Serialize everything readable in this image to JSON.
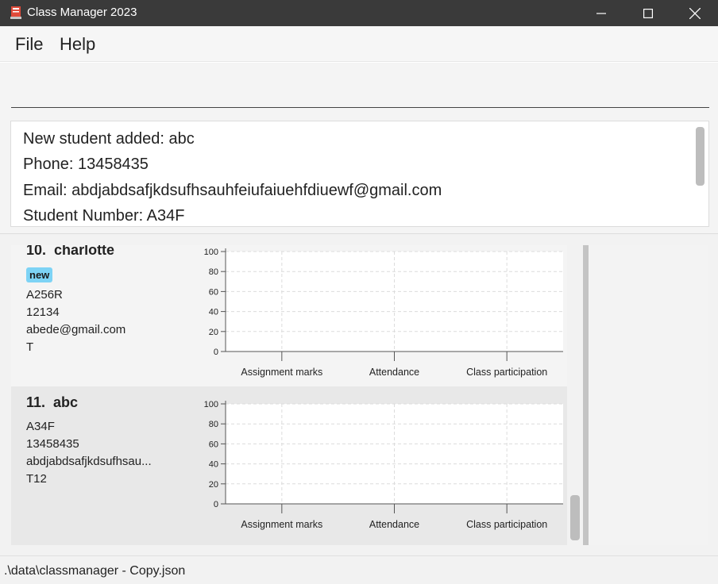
{
  "window": {
    "title": "Class Manager 2023"
  },
  "menu": {
    "file": "File",
    "help": "Help"
  },
  "command": {
    "value": ""
  },
  "result": {
    "lines": [
      "New student added: abc",
      "Phone: 13458435",
      "Email: abdjabdsafjkdsufhsauhfeiufaiuehfdiuewf@gmail.com",
      "Student Number: A34F"
    ]
  },
  "students": [
    {
      "index": "10.",
      "name": "charlotte",
      "tag": "new",
      "student_number": "A256R",
      "phone": "12134",
      "email": "abede@gmail.com",
      "class": "T"
    },
    {
      "index": "11.",
      "name": "abc",
      "student_number": "A34F",
      "phone": "13458435",
      "email": "abdjabdsafjkdsufhsau...",
      "class": "T12"
    }
  ],
  "chart_data": [
    {
      "type": "bar",
      "categories": [
        "Assignment marks",
        "Attendance",
        "Class participation"
      ],
      "values": [
        0,
        0,
        0
      ],
      "ylim": [
        0,
        100
      ],
      "yticks": [
        "0",
        "20",
        "40",
        "60",
        "80",
        "100"
      ],
      "grid": true
    },
    {
      "type": "bar",
      "categories": [
        "Assignment marks",
        "Attendance",
        "Class participation"
      ],
      "values": [
        0,
        0,
        0
      ],
      "ylim": [
        0,
        100
      ],
      "yticks": [
        "0",
        "20",
        "40",
        "60",
        "80",
        "100"
      ],
      "grid": true
    }
  ],
  "status": {
    "file_path": ".\\data\\classmanager - Copy.json"
  },
  "colors": {
    "titlebar": "#3a3a3a",
    "tag": "#7dd3f5",
    "selected_card": "#e8e8e8"
  }
}
